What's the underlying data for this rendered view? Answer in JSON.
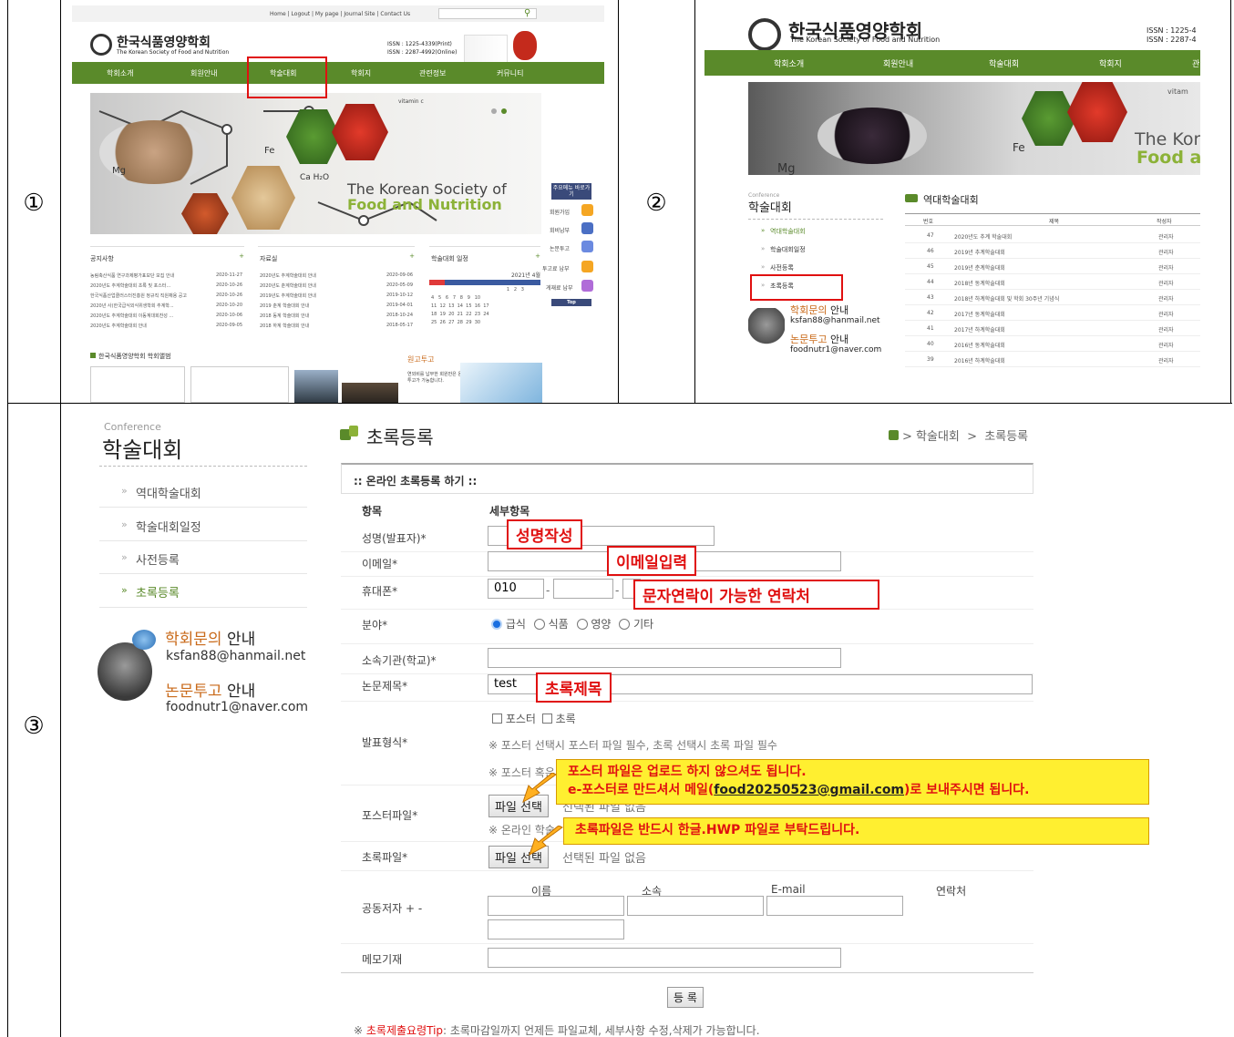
{
  "markers": {
    "p1": "①",
    "p2": "②",
    "p3": "③"
  },
  "s1": {
    "toplinks": "Home  |  Logout  |  My page  |  Journal Site  |  Contact Us",
    "logo_ko": "한국식품영양학회",
    "logo_en": "The Korean Society of Food and Nutrition",
    "issn_print": "ISSN : 1225-4339(Print)",
    "issn_online": "ISSN : 2287-4992(Online)",
    "nav": [
      "학회소개",
      "회원안내",
      "학술대회",
      "학회지",
      "관련정보",
      "커뮤니티"
    ],
    "hero_line1": "The Korean Society of",
    "hero_line2": "Food and Nutrition",
    "hero_vitc": "vitamin c",
    "hero_fe": "Fe",
    "hero_mg": "Mg",
    "hero_ca": "Ca  H₂O",
    "quick_title": "주요메뉴 바로가기",
    "quick": [
      "회원가입",
      "회비납부",
      "논문투고",
      "투고료 납부",
      "게재료 납부"
    ],
    "top_btn": "Top",
    "notice_title": "공지사항",
    "notice": [
      {
        "t": "농림축산식품 연구과제평가표보단 모집 안내",
        "d": "2020-11-27"
      },
      {
        "t": "2020년도 추계학술대회 초록 및 포스터...",
        "d": "2020-10-26"
      },
      {
        "t": "한국식품산업클러스터진흥원 정규직 직원채용 공고",
        "d": "2020-10-26"
      },
      {
        "t": "2020년 사)한국급식외식위생학회 추계학...",
        "d": "2020-10-20"
      },
      {
        "t": "2020년도 추계학술대회 이동계대회찬성 ...",
        "d": "2020-10-06"
      },
      {
        "t": "2020년도 추계학술대회 안내",
        "d": "2020-09-05"
      }
    ],
    "data_title": "자료실",
    "data": [
      {
        "t": "2020년도 추계학술대회 안내",
        "d": "2020-09-06"
      },
      {
        "t": "2020년도 춘계학술대회 안내",
        "d": "2020-05-09"
      },
      {
        "t": "2019년도 추계학술대회 안내",
        "d": "2019-10-12"
      },
      {
        "t": "2019 춘계 학술대회 안내",
        "d": "2019-04-01"
      },
      {
        "t": "2018 동계 학술대회 안내",
        "d": "2018-10-24"
      },
      {
        "t": "2018 하계 학술대회 안내",
        "d": "2018-05-17"
      }
    ],
    "cal_title": "학술대회 일정",
    "cal_month": "2021년 4월",
    "cal_rows": [
      "1   2   3",
      "4   5   6   7   8   9   10",
      "11  12  13  14  15  16  17",
      "18  19  20  21  22  23  24",
      "25  26  27  28  29  30"
    ],
    "album_title": "한국식품영양학회 학회앨범",
    "submit_title": "원고투고",
    "submit_text": "연외비를 납부한 회원만은 온라인 원고투고가 가능합니다."
  },
  "s2": {
    "logo_ko": "한국식품영양학회",
    "logo_en": "The Korean Society of Food and Nutrition",
    "issn1": "ISSN : 1225-4",
    "issn2": "ISSN : 2287-4",
    "nav": [
      "학회소개",
      "회원안내",
      "학술대회",
      "학회지",
      "관"
    ],
    "hero_text1": "The Korea",
    "hero_text2": "Food and",
    "hero_vit": "vitam",
    "hero_fe": "Fe",
    "hero_mg": "Mg",
    "side_small": "Conference",
    "side_title": "학술대회",
    "side_items": [
      "역대학술대회",
      "학술대회일정",
      "사전등록",
      "초록등록"
    ],
    "contact1_title": "학회문의",
    "contact1_suffix": "안내",
    "contact1_email": "ksfan88@hanmail.net",
    "contact2_title": "논문투고",
    "contact2_suffix": "안내",
    "contact2_email": "foodnutr1@naver.com",
    "board_title": "역대학술대회",
    "cols": [
      "번호",
      "제목",
      "작성자"
    ],
    "rows": [
      {
        "n": "47",
        "t": "2020년도 추계 학술대회",
        "w": "관리자"
      },
      {
        "n": "46",
        "t": "2019년 추계학술대회",
        "w": "관리자"
      },
      {
        "n": "45",
        "t": "2019년 춘계학술대회",
        "w": "관리자"
      },
      {
        "n": "44",
        "t": "2018년 동계학술대회",
        "w": "관리자"
      },
      {
        "n": "43",
        "t": "2018년 하계학술대회 및 학회 30주년 기념식",
        "w": "관리자"
      },
      {
        "n": "42",
        "t": "2017년 동계학술대회",
        "w": "관리자"
      },
      {
        "n": "41",
        "t": "2017년 하계학술대회",
        "w": "관리자"
      },
      {
        "n": "40",
        "t": "2016년 동계학술대회",
        "w": "관리자"
      },
      {
        "n": "39",
        "t": "2016년 하계학술대회",
        "w": "관리자"
      }
    ]
  },
  "s3": {
    "side_small": "Conference",
    "side_title": "학술대회",
    "side_items": [
      "역대학술대회",
      "학술대회일정",
      "사전등록",
      "초록등록"
    ],
    "contact1_title": "학회문의",
    "contact1_suffix": "안내",
    "contact1_email": "ksfan88@hanmail.net",
    "contact2_title": "논문투고",
    "contact2_suffix": "안내",
    "contact2_email": "foodnutr1@naver.com",
    "page_title": "초록등록",
    "breadcrumb": "> 학술대회  >  초록등록",
    "form_header": ":: 온라인 초록등록 하기 ::",
    "col_item": "항목",
    "col_detail": "세부항목",
    "labels": {
      "name": "성명(발표자)*",
      "email": "이메일*",
      "phone": "휴대폰*",
      "field": "분야*",
      "org": "소속기관(학교)*",
      "title": "논문제목*",
      "type": "발표형식*",
      "poster": "포스터파일*",
      "abstract": "초록파일*",
      "coauthor": "공동저자 + -",
      "memo": "메모기재"
    },
    "phone_prefix": "010",
    "phone_dash": "-",
    "field_options": [
      "급식",
      "식품",
      "영양",
      "기타"
    ],
    "title_value": "test",
    "type_options": [
      "포스터",
      "초록"
    ],
    "type_note1": "※ 포스터 선택시 포스터 파일 필수, 초록 선택시 초록 파일 필수",
    "type_note2": "※ 포스터 혹은",
    "file_btn": "파일 선택",
    "no_file": "선택된 파일 없음",
    "online_note": "※ 온라인 학술",
    "coauthor_cols": [
      "이름",
      "소속",
      "E-mail",
      "연락처"
    ],
    "submit": "등 록",
    "tip_prefix": "※ ",
    "tip_label": "초록제출요령Tip",
    "tip_text": ": 초록마감일까지 언제든 파일교체, 세부사항 수정,삭제가 가능합니다.",
    "callouts": {
      "name": "성명작성",
      "email": "이메일입력",
      "phone": "문자연락이 가능한 연락처",
      "title": "초록제목"
    },
    "notice1_line1": "포스터 파일은 업로드 하지 않으셔도 됩니다.",
    "notice1_line2_a": "e-포스터로 만드셔서 메일(",
    "notice1_email": "food20250523@gmail.com",
    "notice1_line2_b": ")로  보내주시면 됩니다.",
    "notice2": "초록파일은 반드시 한글.HWP 파일로 부탁드립니다."
  }
}
